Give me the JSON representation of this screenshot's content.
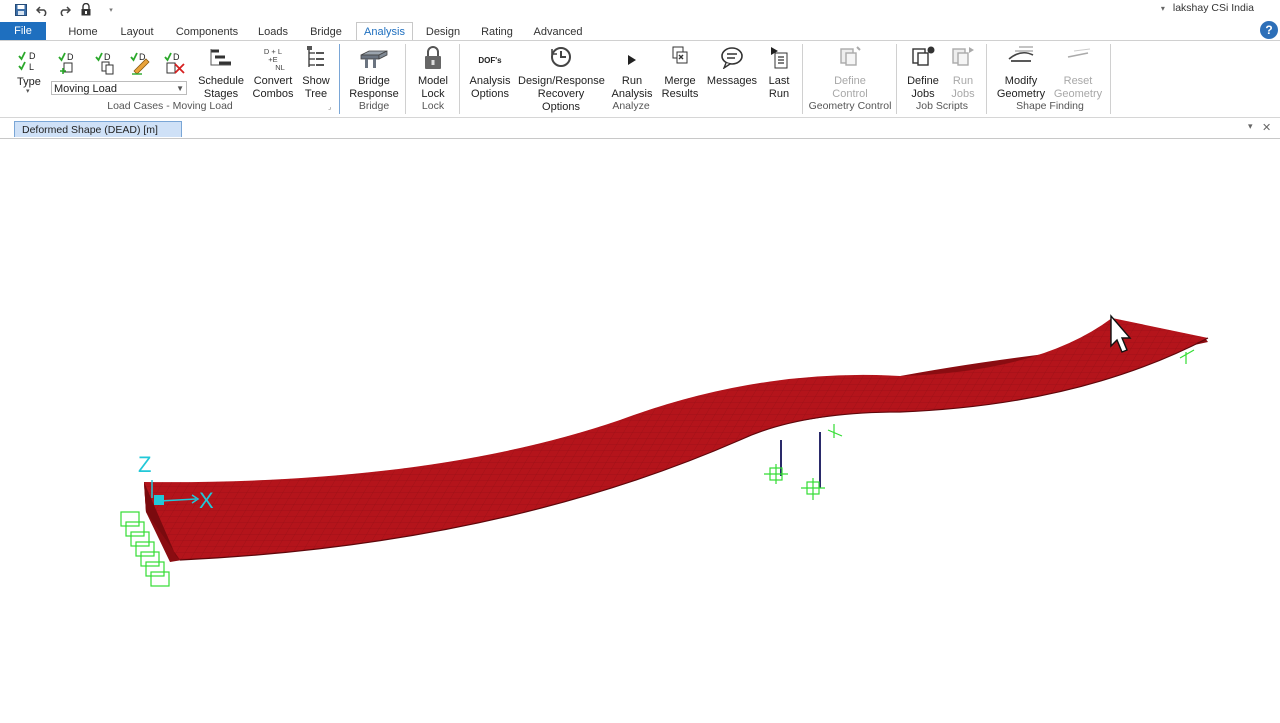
{
  "qat": {
    "icons": [
      "save-icon",
      "undo-icon",
      "redo-icon",
      "lock-icon",
      "dropdown-arrow-icon"
    ]
  },
  "user": {
    "name": "lakshay CSi India"
  },
  "tabs": {
    "file": "File",
    "home": "Home",
    "layout": "Layout",
    "components": "Components",
    "loads": "Loads",
    "bridge": "Bridge",
    "analysis": "Analysis",
    "design": "Design",
    "rating": "Rating",
    "advanced": "Advanced"
  },
  "help": "?",
  "load_cases": {
    "type_label": "Type",
    "dropdown_value": "Moving Load",
    "group_label": "Load Cases - Moving Load",
    "check_d": "D",
    "check_l": "L"
  },
  "buttons": {
    "schedule_stages": [
      "Schedule",
      "Stages"
    ],
    "convert_combos": [
      "Convert",
      "Combos"
    ],
    "convert_icon_text": [
      "D + L",
      "+E",
      "NL"
    ],
    "show_tree": [
      "Show",
      "Tree"
    ],
    "bridge_response": [
      "Bridge",
      "Response"
    ],
    "model_lock": [
      "Model",
      "Lock"
    ],
    "analysis_options": [
      "Analysis",
      "Options"
    ],
    "dofs_icon_text": "DOF's",
    "design_response_recovery": [
      "Design/Response",
      "Recovery Options"
    ],
    "run_analysis": [
      "Run",
      "Analysis"
    ],
    "merge_results": [
      "Merge",
      "Results"
    ],
    "messages": [
      "Messages"
    ],
    "last_run": [
      "Last",
      "Run"
    ],
    "define_control": [
      "Define",
      "Control"
    ],
    "define_jobs": [
      "Define",
      "Jobs"
    ],
    "run_jobs": [
      "Run",
      "Jobs"
    ],
    "modify_geometry": [
      "Modify",
      "Geometry"
    ],
    "reset_geometry": [
      "Reset",
      "Geometry"
    ]
  },
  "groups": {
    "bridge": "Bridge",
    "lock": "Lock",
    "analyze": "Analyze",
    "geometry_control": "Geometry Control",
    "job_scripts": "Job Scripts",
    "shape_finding": "Shape Finding"
  },
  "doc_tab": {
    "title": "Deformed Shape (DEAD)  [m]",
    "menu_icon": "▾",
    "close_icon": "✕"
  },
  "axes": {
    "z": "Z",
    "x": "X"
  },
  "colors": {
    "accent": "#1e6fbf",
    "deck": "#b4141b",
    "deck_dark": "#8a0c11",
    "support": "#33dd33",
    "axis": "#22c8d8",
    "column": "#2a2a6a"
  }
}
